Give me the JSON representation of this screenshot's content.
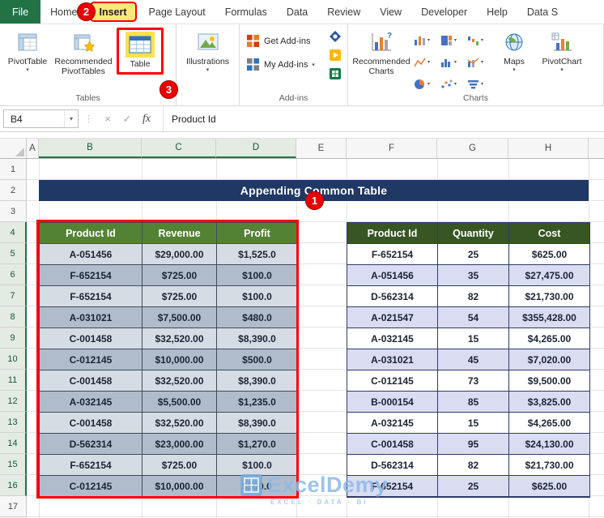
{
  "ribbon": {
    "tabs": [
      "File",
      "Home",
      "Insert",
      "Page Layout",
      "Formulas",
      "Data",
      "Review",
      "View",
      "Developer",
      "Help",
      "Data S"
    ],
    "tables_group": {
      "label": "Tables",
      "pivottable": "PivotTable",
      "recommended_pivottables": "Recommended PivotTables",
      "table": "Table"
    },
    "illustrations": {
      "label": "Illustrations"
    },
    "addins_group": {
      "label": "Add-ins",
      "get_addins": "Get Add-ins",
      "my_addins": "My Add-ins"
    },
    "charts_group": {
      "label": "Charts",
      "recommended_charts": "Recommended Charts",
      "maps": "Maps",
      "pivotchart": "PivotChart"
    }
  },
  "formula_bar": {
    "name_box": "B4",
    "fx_label": "fx",
    "content": "Product Id"
  },
  "sheet": {
    "columns": [
      "A",
      "B",
      "C",
      "D",
      "E",
      "F",
      "G",
      "H"
    ],
    "rows": [
      "1",
      "2",
      "3",
      "4",
      "5",
      "6",
      "7",
      "8",
      "9",
      "10",
      "11",
      "12",
      "13",
      "14",
      "15",
      "16",
      "17"
    ],
    "title_banner": "Appending Common Table",
    "selection": {
      "cols": [
        "B",
        "C",
        "D"
      ],
      "row_from": 4,
      "row_to": 16
    }
  },
  "left_table": {
    "headers": [
      "Product Id",
      "Revenue",
      "Profit"
    ],
    "rows": [
      [
        "A-051456",
        "$29,000.00",
        "$1,525.0"
      ],
      [
        "F-652154",
        "$725.00",
        "$100.0"
      ],
      [
        "F-652154",
        "$725.00",
        "$100.0"
      ],
      [
        "A-031021",
        "$7,500.00",
        "$480.0"
      ],
      [
        "C-001458",
        "$32,520.00",
        "$8,390.0"
      ],
      [
        "C-012145",
        "$10,000.00",
        "$500.0"
      ],
      [
        "C-001458",
        "$32,520.00",
        "$8,390.0"
      ],
      [
        "A-032145",
        "$5,500.00",
        "$1,235.0"
      ],
      [
        "C-001458",
        "$32,520.00",
        "$8,390.0"
      ],
      [
        "D-562314",
        "$23,000.00",
        "$1,270.0"
      ],
      [
        "F-652154",
        "$725.00",
        "$100.0"
      ],
      [
        "C-012145",
        "$10,000.00",
        "$500.0"
      ]
    ]
  },
  "right_table": {
    "headers": [
      "Product Id",
      "Quantity",
      "Cost"
    ],
    "rows": [
      [
        "F-652154",
        "25",
        "$625.00"
      ],
      [
        "A-051456",
        "35",
        "$27,475.00"
      ],
      [
        "D-562314",
        "82",
        "$21,730.00"
      ],
      [
        "A-021547",
        "54",
        "$355,428.00"
      ],
      [
        "A-032145",
        "15",
        "$4,265.00"
      ],
      [
        "A-031021",
        "45",
        "$7,020.00"
      ],
      [
        "C-012145",
        "73",
        "$9,500.00"
      ],
      [
        "B-000154",
        "85",
        "$3,825.00"
      ],
      [
        "A-032145",
        "15",
        "$4,265.00"
      ],
      [
        "C-001458",
        "95",
        "$24,130.00"
      ],
      [
        "D-562314",
        "82",
        "$21,730.00"
      ],
      [
        "F-652154",
        "25",
        "$625.00"
      ]
    ]
  },
  "annotations": {
    "step1": "1",
    "step2": "2",
    "step3": "3"
  },
  "watermark": {
    "brand": "ExcelDemy",
    "tagline": "EXCEL · DATA · BI"
  },
  "icons": {
    "chevron_down": "▾",
    "cancel": "×",
    "enter": "✓",
    "grip": "⋮"
  },
  "colors": {
    "excel_green": "#217346",
    "title_banner_bg": "#1F3864",
    "left_table_header_bg": "#548235",
    "right_table_header_bg": "#375623",
    "annotation_red": "#FF0000",
    "badge_red": "#E60000",
    "left_row_light": "#D6DCE4",
    "left_row_dark": "#B0BCCC",
    "right_row_light": "#FFFFFF",
    "right_row_shade": "#DADCF2"
  }
}
